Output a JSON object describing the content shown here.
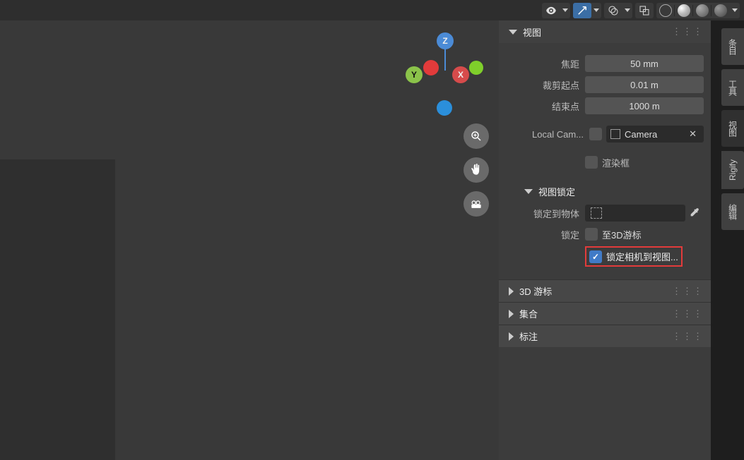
{
  "header": {
    "gizmo_labels": {
      "x": "X",
      "y": "Y",
      "z": "Z"
    }
  },
  "panel": {
    "view": {
      "title": "视图",
      "focal_label": "焦距",
      "focal_value": "50 mm",
      "clip_start_label": "裁剪起点",
      "clip_start_value": "0.01 m",
      "clip_end_label": "结束点",
      "clip_end_value": "1000 m",
      "local_camera_label": "Local Cam...",
      "camera_name": "Camera",
      "render_frame_label": "渲染框"
    },
    "view_lock": {
      "title": "视图锁定",
      "lock_to_object_label": "锁定到物体",
      "lock_label": "锁定",
      "to_3d_cursor_label": "至3D游标",
      "lock_camera_label": "锁定相机到视图..."
    },
    "cursor_title": "3D 游标",
    "collection_title": "集合",
    "annotation_title": "标注"
  },
  "tabs": {
    "t1": "条目",
    "t2": "工具",
    "t3": "视图",
    "t4": "Rigify",
    "t5": "编辑"
  }
}
